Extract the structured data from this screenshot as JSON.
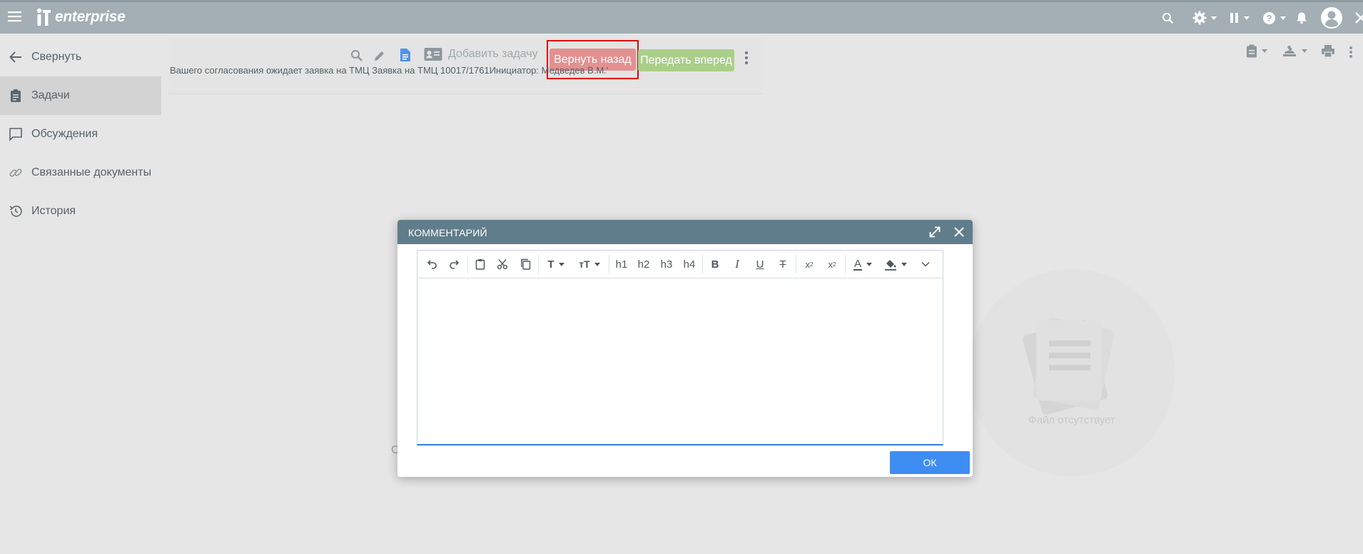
{
  "app": {
    "logo_text": "enterprise"
  },
  "topbar_icons": [
    "menu-icon",
    "search-icon",
    "gear-icon",
    "pause-icon",
    "help-icon",
    "bell-icon",
    "user-avatar-icon",
    "close-icon"
  ],
  "sidebar": {
    "items": [
      {
        "label": "Свернуть",
        "icon": "arrow-left-icon",
        "active": false
      },
      {
        "label": "Задачи",
        "icon": "clipboard-icon",
        "active": true
      },
      {
        "label": "Обсуждения",
        "icon": "chat-icon",
        "active": false
      },
      {
        "label": "Связанные документы",
        "icon": "link-icon",
        "active": false
      },
      {
        "label": "История",
        "icon": "history-icon",
        "active": false
      }
    ]
  },
  "task": {
    "add_task_label": "Добавить задачу",
    "return_back_label": "Вернуть назад",
    "pass_forward_label": "Передать вперед",
    "description": "Вашего согласования ожидает заявка на ТМЦ Заявка на ТМЦ 10017/1761Инициатор: Медведев В.М.'",
    "body_fragment": "О",
    "colors": {
      "return_back": "#e39090",
      "pass_forward": "#a9cf8a",
      "highlight": "#e5000e"
    }
  },
  "preview": {
    "empty_label": "Файл отсутствует"
  },
  "dialog": {
    "title": "КОММЕНТАРИЙ",
    "ok_label": "ОК",
    "header_color": "#607d8b",
    "toolbar": {
      "undo": "undo-icon",
      "redo": "redo-icon",
      "paste": "paste-icon",
      "cut": "cut-icon",
      "copy": "copy-icon",
      "font": "T",
      "font_size": "тТ",
      "h1": "h1",
      "h2": "h2",
      "h3": "h3",
      "h4": "h4",
      "bold": "B",
      "italic": "I",
      "underline": "U",
      "strike": "T",
      "subscript": "x",
      "subscript_mark": "2",
      "superscript": "x",
      "superscript_mark": "2",
      "font_color": "A"
    },
    "text_value": ""
  }
}
